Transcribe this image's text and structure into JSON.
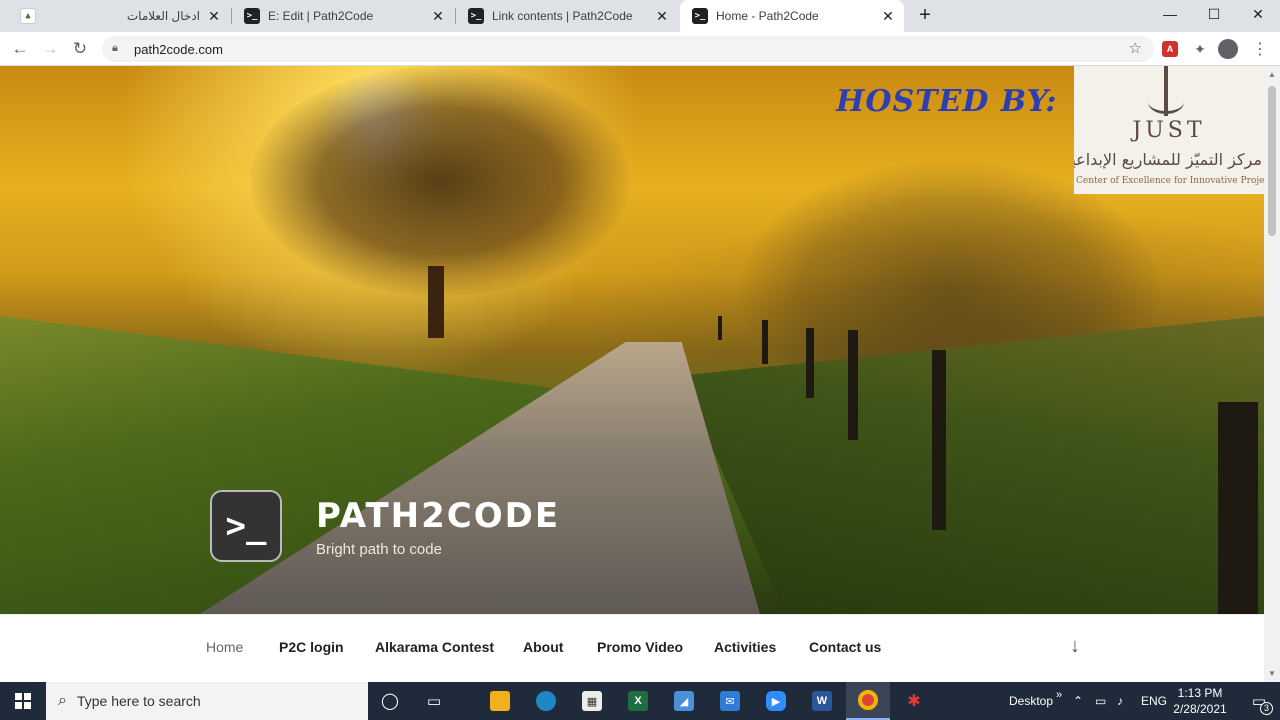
{
  "browser": {
    "tabs": [
      {
        "title": "ادخال العلامات",
        "close": "✕",
        "icon": "bookmark-icon"
      },
      {
        "title": "E: Edit | Path2Code",
        "close": "✕",
        "icon": "terminal-icon"
      },
      {
        "title": "Link contents | Path2Code",
        "close": "✕",
        "icon": "terminal-icon"
      },
      {
        "title": "Home - Path2Code",
        "close": "✕",
        "icon": "terminal-icon"
      }
    ],
    "new_tab": "+",
    "window_controls": {
      "minimize": "—",
      "maximize": "☐",
      "close": "✕"
    },
    "nav": {
      "back": "←",
      "forward": "→",
      "reload": "↻"
    },
    "url": "path2code.com",
    "bookmark_star": "☆"
  },
  "page": {
    "hosted_by": "HOSTED BY:",
    "sponsor": {
      "name": "JUST",
      "arabic": "مركز التميّز للمشاريع الإبداعية",
      "english": "Center of Excellence for Innovative Projects"
    },
    "logo_glyph": ">_",
    "site_title": "PATH2CODE",
    "tagline": "Bright path to code",
    "nav": [
      {
        "label": "Home",
        "active": true
      },
      {
        "label": "P2C login"
      },
      {
        "label": "Alkarama Contest"
      },
      {
        "label": "About"
      },
      {
        "label": "Promo Video"
      },
      {
        "label": "Activities"
      },
      {
        "label": "Contact us"
      }
    ],
    "scroll_down": "↓"
  },
  "taskbar": {
    "search_placeholder": "Type here to search",
    "desktop_label": "Desktop",
    "chevron": "»",
    "language": "ENG",
    "time": "1:13 PM",
    "date": "2/28/2021",
    "notification_count": "3"
  },
  "colors": {
    "hosted_by": "#2b3fb0",
    "tab_strip": "#dee1e6",
    "taskbar": "#1f2a3a"
  }
}
